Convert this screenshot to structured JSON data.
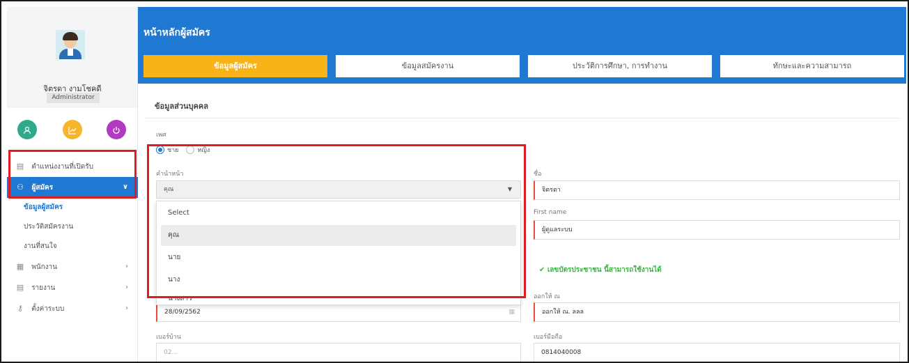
{
  "sidebar": {
    "profile": {
      "name": "จิตรดา งามโชคดี",
      "role": "Administrator"
    },
    "quick_icons": [
      "user-icon",
      "chart-icon",
      "power-icon"
    ],
    "menu": [
      {
        "label": "ตำแหน่งงานที่เปิดรับ",
        "icon": "list-icon"
      },
      {
        "label": "ผู้สมัคร",
        "icon": "users-icon",
        "active": true
      },
      {
        "label": "พนักงาน",
        "icon": "building-icon"
      },
      {
        "label": "รายงาน",
        "icon": "report-icon"
      },
      {
        "label": "ตั้งค่าระบบ",
        "icon": "key-icon"
      }
    ],
    "submenu": [
      {
        "label": "ข้อมูลผู้สมัคร",
        "current": true
      },
      {
        "label": "ประวัติสมัครงาน"
      },
      {
        "label": "งานที่สนใจ"
      }
    ]
  },
  "header": {
    "title": "หน้าหลักผู้สมัคร",
    "tabs": [
      {
        "label": "ข้อมูลผู้สมัคร",
        "active": true
      },
      {
        "label": "ข้อมูลสมัครงาน"
      },
      {
        "label": "ประวัติการศึกษา, การทำงาน"
      },
      {
        "label": "ทักษะและความสามารถ"
      }
    ]
  },
  "form": {
    "section_title": "ข้อมูลส่วนบุคคล",
    "gender_label": "เพศ",
    "gender_options": [
      "ชาย",
      "หญิง"
    ],
    "gender_selected": "ชาย",
    "prefix_label": "คำนำหน้า",
    "prefix_value": "คุณ",
    "dropdown_options": [
      "Select",
      "คุณ",
      "นาย",
      "นาง",
      "นางสาว"
    ],
    "first_name_label": "ชื่อ",
    "first_name_value": "จิตรดา",
    "first_name_en_label": "First name",
    "first_name_en_value": "ผู้ดูแลระบบ",
    "id_status": "เลขบัตรประชาชน นี้สามารถใช้งานได้",
    "issue_date_value": "28/09/2562",
    "issued_at_label": "ออกให้ ณ",
    "issued_at_value": "ออกให้ ณ. ลลล",
    "home_phone_label": "เบอร์บ้าน",
    "home_phone_placeholder": "02...",
    "mobile_label": "เบอร์มือถือ",
    "mobile_value": "0814040008"
  },
  "colors": {
    "primary": "#1f78d1",
    "accent": "#f8b319",
    "highlight": "#e01b22",
    "success": "#3cb043"
  }
}
